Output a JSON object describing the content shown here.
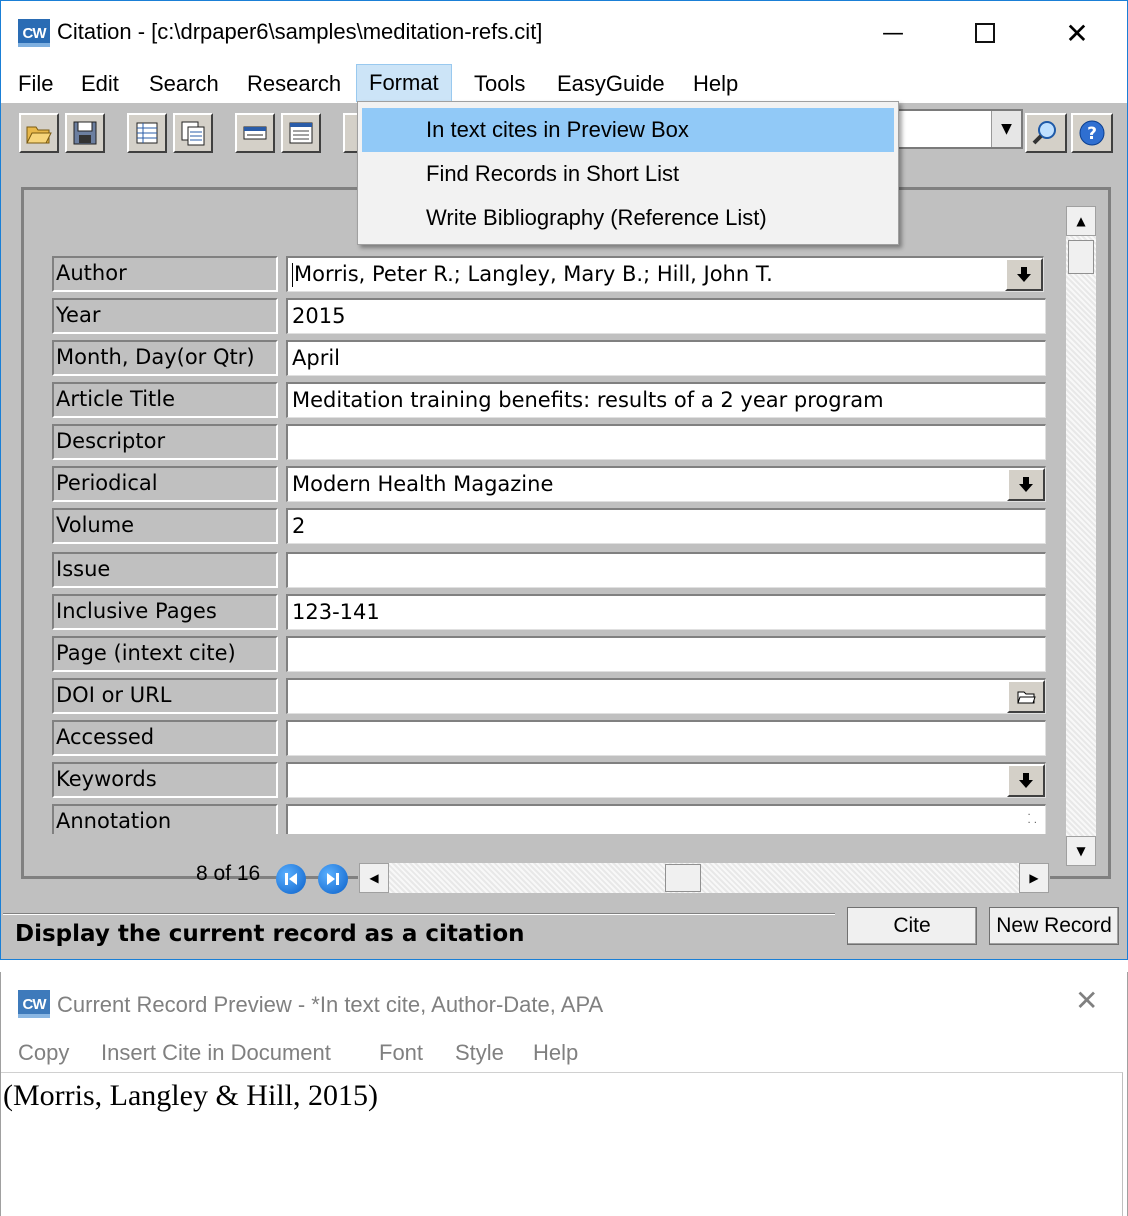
{
  "main_window": {
    "title": "Citation - [c:\\drpaper6\\samples\\meditation-refs.cit]",
    "logo": "CW",
    "controls": {
      "minimize": "—",
      "close": "✕"
    }
  },
  "menu": [
    "File",
    "Edit",
    "Search",
    "Research",
    "Format",
    "Tools",
    "EasyGuide",
    "Help"
  ],
  "format_menu": {
    "open": true,
    "items": [
      {
        "label": "In text cites in Preview Box",
        "highlighted": true
      },
      {
        "label": "Find Records in Short List",
        "highlighted": false
      },
      {
        "label": "Write Bibliography (Reference List)",
        "highlighted": false
      }
    ]
  },
  "toolbar": {
    "icons": [
      "open-folder-icon",
      "save-disk-icon",
      "list-view-icon",
      "copy-record-icon",
      "minimize-field-icon",
      "form-view-icon",
      "zoom-icon",
      "help-icon"
    ]
  },
  "record": {
    "fields": [
      {
        "label": "Author",
        "value": "Morris, Peter R.; Langley, Mary B.; Hill, John T.",
        "button": "dropdown"
      },
      {
        "label": "Year",
        "value": "2015"
      },
      {
        "label": "Month, Day(or Qtr)",
        "value": "April"
      },
      {
        "label": "Article Title",
        "value": "Meditation training benefits: results of a 2 year program"
      },
      {
        "label": "Descriptor",
        "value": ""
      },
      {
        "label": "Periodical",
        "value": "Modern Health Magazine",
        "button": "dropdown"
      },
      {
        "label": "Volume",
        "value": "2"
      },
      {
        "label": "Issue",
        "value": ""
      },
      {
        "label": "Inclusive Pages",
        "value": "123-141"
      },
      {
        "label": "Page (intext cite)",
        "value": ""
      },
      {
        "label": "DOI or URL",
        "value": "",
        "button": "folder"
      },
      {
        "label": "Accessed",
        "value": ""
      },
      {
        "label": "Keywords",
        "value": "",
        "button": "dropdown"
      },
      {
        "label": "Annotation",
        "value": ""
      }
    ],
    "counter": "8 of 16"
  },
  "status": {
    "text": "Display the current record as a citation",
    "cite_button": "Cite",
    "new_record_button": "New Record"
  },
  "preview": {
    "logo": "CW",
    "title": "Current Record Preview - *In text cite, Author-Date, APA",
    "close": "✕",
    "menu": [
      "Copy",
      "Insert Cite in Document",
      "Font",
      "Style",
      "Help"
    ],
    "citation": "(Morris, Langley & Hill, 2015)"
  },
  "colors": {
    "window_border": "#1a7fd6",
    "panel_gray": "#c0c0c0",
    "menu_highlight": "#91c9f7",
    "nav_blue": "#0a5fc8"
  }
}
